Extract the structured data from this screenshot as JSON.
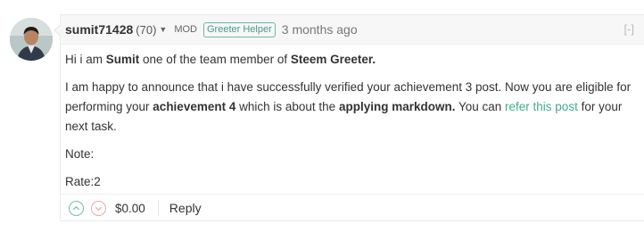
{
  "comment": {
    "author": "sumit71428",
    "reputation": "(70)",
    "role_label": "MOD",
    "badge": "Greeter Helper",
    "time": "3 months ago",
    "collapse_label": "[-]",
    "body": {
      "p1": {
        "a": "Hi i am ",
        "b": "Sumit",
        "c": " one of the team member of ",
        "d": "Steem Greeter."
      },
      "p2": {
        "a": "I am happy to announce that i have successfully verified your achievement 3 post. Now you are eligible for performing your ",
        "b": "achievement 4",
        "c": " which is about the ",
        "d": "applying markdown.",
        "e": " You can ",
        "link": "refer this post",
        "f": " for your next task."
      },
      "note": "Note:",
      "rate": "Rate:2"
    },
    "footer": {
      "payout": "$0.00",
      "reply_label": "Reply"
    }
  },
  "colors": {
    "link": "#3fae8a",
    "badge_border": "#66bba8",
    "upvote": "#6fbfa8",
    "downvote": "#e8a8a8"
  },
  "icons": {
    "upvote": "chevron-up-circle-icon",
    "downvote": "chevron-down-circle-icon",
    "dropdown": "caret-down-icon"
  }
}
